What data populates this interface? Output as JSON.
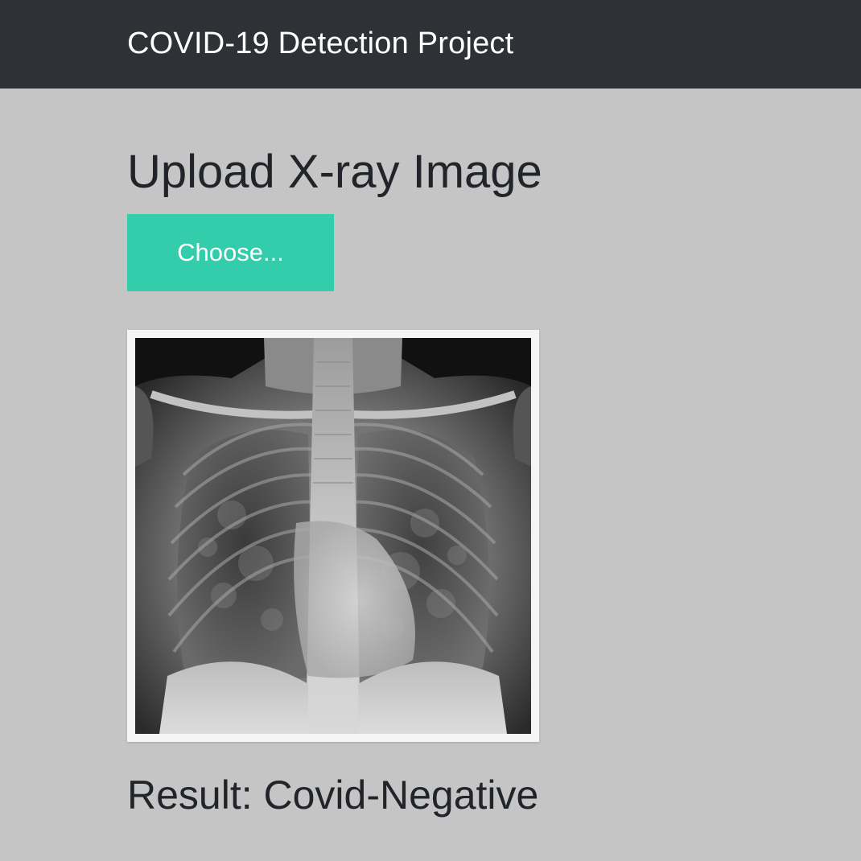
{
  "navbar": {
    "brand": "COVID-19 Detection Project"
  },
  "main": {
    "title": "Upload X-ray Image",
    "choose_label": "Choose...",
    "result_prefix": "Result: ",
    "result_value": "Covid-Negative"
  },
  "colors": {
    "navbar_bg": "#2e3236",
    "page_bg": "#c5c5c5",
    "accent": "#33cdac",
    "text": "#212529"
  }
}
